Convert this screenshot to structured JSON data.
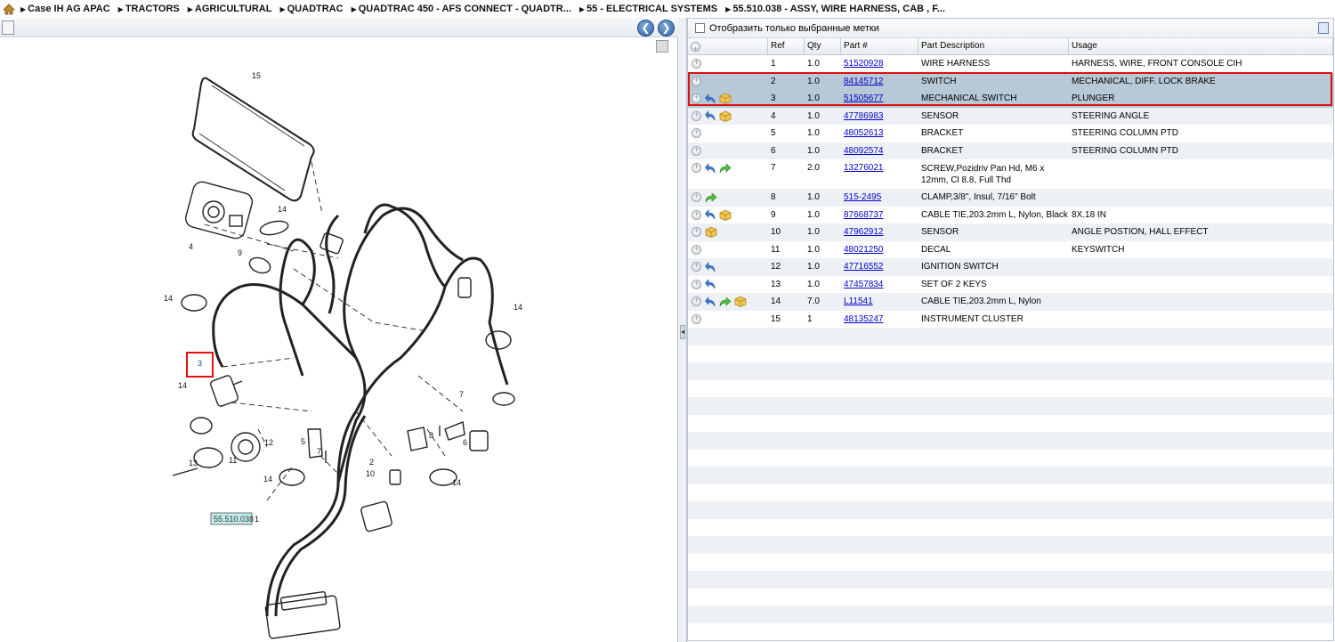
{
  "breadcrumb": [
    "Case IH AG APAC",
    "TRACTORS",
    "AGRICULTURAL",
    "QUADTRAC",
    "QUADTRAC 450 - AFS CONNECT - QUADTR...",
    "55 - ELECTRICAL SYSTEMS",
    "55.510.038 - ASSY, WIRE HARNESS, CAB , F..."
  ],
  "filter": {
    "label": "Отобразить только выбранные метки",
    "checked": false
  },
  "grid": {
    "headers": {
      "ref": "Ref",
      "qty": "Qty",
      "part": "Part #",
      "desc": "Part Description",
      "usage": "Usage"
    },
    "rows": [
      {
        "ref": "1",
        "qty": "1.0",
        "part": "51520928",
        "desc": "WIRE HARNESS",
        "usage": "HARNESS, WIRE, FRONT CONSOLE CIH",
        "icons": [],
        "selected": false
      },
      {
        "ref": "2",
        "qty": "1.0",
        "part": "84145712",
        "desc": "SWITCH",
        "usage": "MECHANICAL, DIFF. LOCK BRAKE",
        "icons": [],
        "selected": true
      },
      {
        "ref": "3",
        "qty": "1.0",
        "part": "51505677",
        "desc": "MECHANICAL SWITCH",
        "usage": "PLUNGER",
        "icons": [
          "back",
          "box"
        ],
        "selected": true
      },
      {
        "ref": "4",
        "qty": "1.0",
        "part": "47786983",
        "desc": "SENSOR",
        "usage": "STEERING ANGLE",
        "icons": [
          "back",
          "box"
        ],
        "selected": false
      },
      {
        "ref": "5",
        "qty": "1.0",
        "part": "48052613",
        "desc": "BRACKET",
        "usage": "STEERING COLUMN PTD",
        "icons": [],
        "selected": false
      },
      {
        "ref": "6",
        "qty": "1.0",
        "part": "48092574",
        "desc": "BRACKET",
        "usage": "STEERING COLUMN PTD",
        "icons": [],
        "selected": false
      },
      {
        "ref": "7",
        "qty": "2.0",
        "part": "13276021",
        "desc": "SCREW,Pozidriv Pan Hd, M6 x 12mm, Cl 8.8, Full Thd",
        "usage": "",
        "icons": [
          "back",
          "fwd"
        ],
        "selected": false,
        "tall": true
      },
      {
        "ref": "8",
        "qty": "1.0",
        "part": "515-2495",
        "desc": "CLAMP,3/8\", Insul, 7/16\" Bolt",
        "usage": "",
        "icons": [
          "fwd"
        ],
        "selected": false
      },
      {
        "ref": "9",
        "qty": "1.0",
        "part": "87668737",
        "desc": "CABLE TIE,203.2mm L, Nylon, Black",
        "usage": "8X.18 IN",
        "icons": [
          "back",
          "box"
        ],
        "selected": false
      },
      {
        "ref": "10",
        "qty": "1.0",
        "part": "47962912",
        "desc": "SENSOR",
        "usage": "ANGLE POSTION, HALL EFFECT",
        "icons": [
          "box"
        ],
        "selected": false
      },
      {
        "ref": "11",
        "qty": "1.0",
        "part": "48021250",
        "desc": "DECAL",
        "usage": "KEYSWITCH",
        "icons": [],
        "selected": false
      },
      {
        "ref": "12",
        "qty": "1.0",
        "part": "47716552",
        "desc": "IGNITION SWITCH",
        "usage": "",
        "icons": [
          "back"
        ],
        "selected": false
      },
      {
        "ref": "13",
        "qty": "1.0",
        "part": "47457834",
        "desc": "SET OF 2 KEYS",
        "usage": "",
        "icons": [
          "back"
        ],
        "selected": false
      },
      {
        "ref": "14",
        "qty": "7.0",
        "part": "L11541",
        "desc": "CABLE TIE,203.2mm L, Nylon",
        "usage": "",
        "icons": [
          "back",
          "fwd",
          "box"
        ],
        "selected": false
      },
      {
        "ref": "15",
        "qty": "1",
        "part": "48135247",
        "desc": "INSTRUMENT CLUSTER",
        "usage": "",
        "icons": [],
        "selected": false
      }
    ]
  },
  "diagram": {
    "labels": [
      "15",
      "14",
      "4",
      "9",
      "14",
      "3",
      "14",
      "12",
      "11",
      "13",
      "14",
      "5",
      "7",
      "2",
      "10",
      "7",
      "8",
      "6",
      "14",
      "14",
      "1"
    ],
    "callout": "55.510.038",
    "highlight_label": "3"
  },
  "colors": {
    "selection": "#b7c8d6",
    "highlight": "#e01010",
    "link": "#0000cc"
  }
}
